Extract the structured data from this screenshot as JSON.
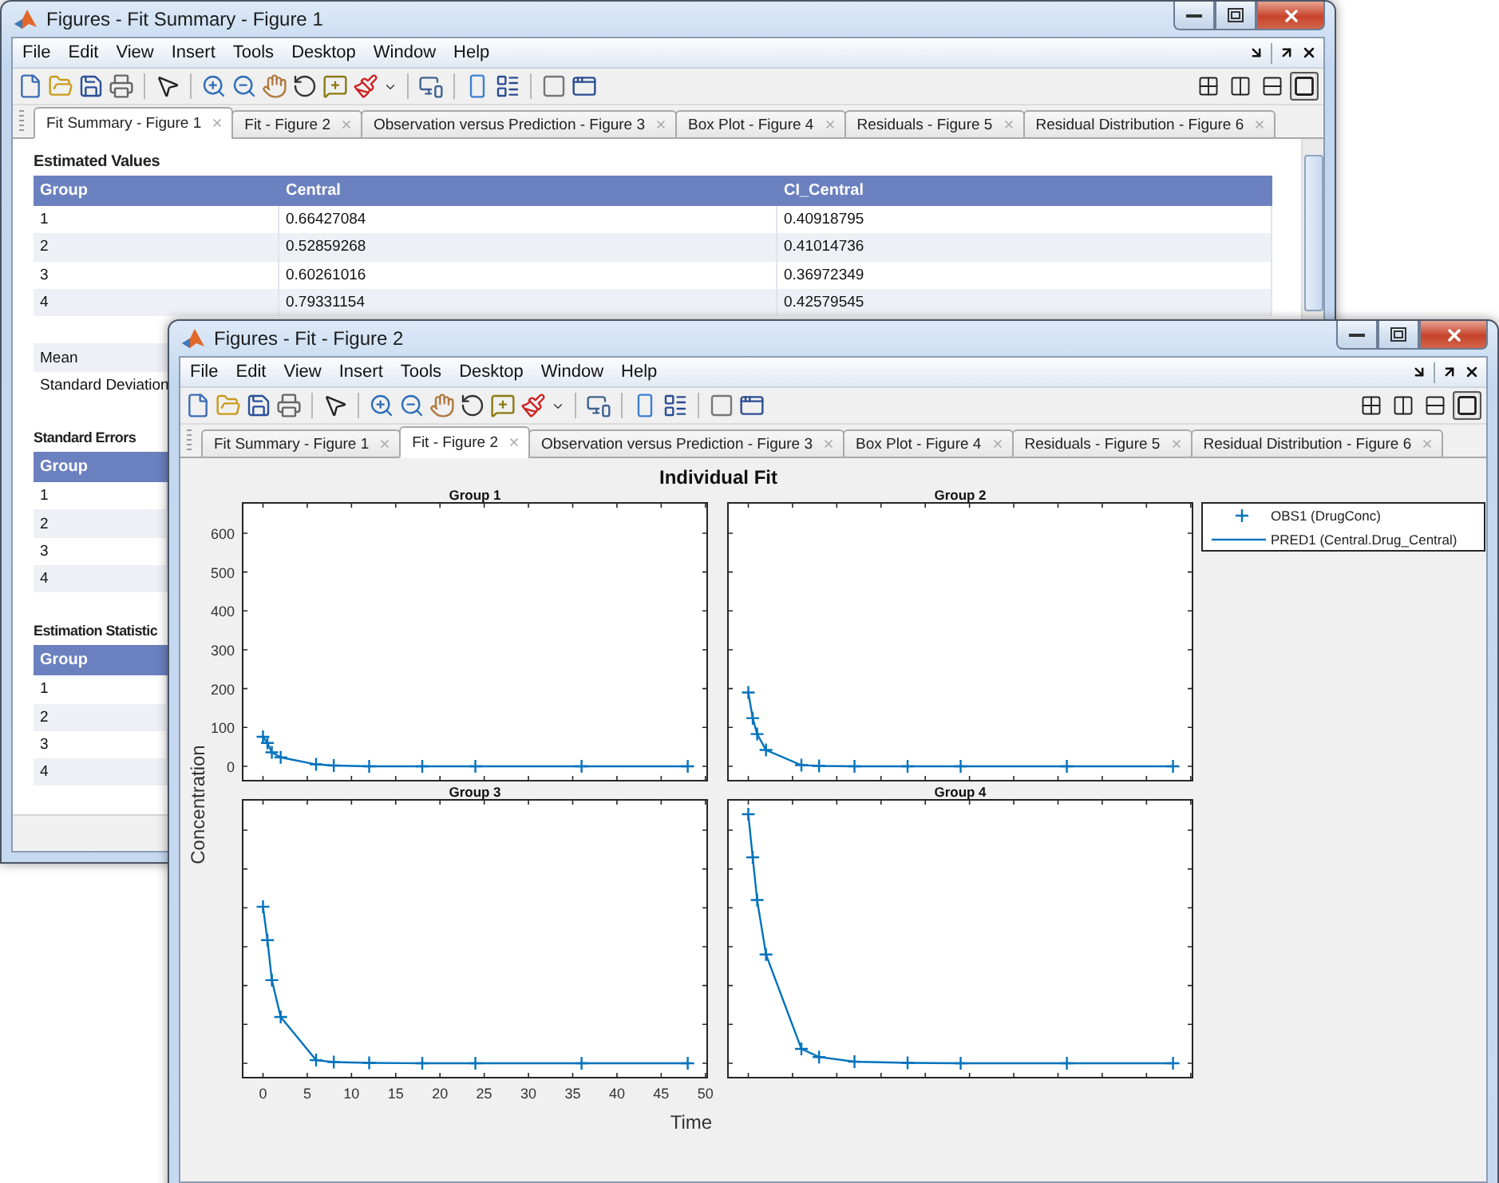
{
  "windows": [
    {
      "title": "Figures - Fit Summary - Figure 1",
      "menu": [
        "File",
        "Edit",
        "View",
        "Insert",
        "Tools",
        "Desktop",
        "Window",
        "Help"
      ],
      "layouts": [
        {
          "kind": "grid",
          "selected": false
        },
        {
          "kind": "columns",
          "selected": false
        },
        {
          "kind": "rows",
          "selected": false
        },
        {
          "kind": "single",
          "selected": true
        }
      ],
      "tabs": [
        {
          "label": "Fit Summary - Figure 1",
          "selected": true
        },
        {
          "label": "Fit - Figure 2",
          "selected": false
        },
        {
          "label": "Observation versus Prediction - Figure 3",
          "selected": false
        },
        {
          "label": "Box Plot - Figure 4",
          "selected": false
        },
        {
          "label": "Residuals - Figure 5",
          "selected": false
        },
        {
          "label": "Residual Distribution - Figure 6",
          "selected": false
        }
      ],
      "content": {
        "kind": "summary",
        "sections": [
          {
            "title": "Estimated Values",
            "columns": [
              "Group",
              "Central",
              "CI_Central"
            ],
            "rows": [
              {
                "kind": "data",
                "cells": [
                  "1",
                  "0.66427084",
                  "0.40918795"
                ]
              },
              {
                "kind": "data",
                "cells": [
                  "2",
                  "0.52859268",
                  "0.41014736"
                ]
              },
              {
                "kind": "data",
                "cells": [
                  "3",
                  "0.60261016",
                  "0.36972349"
                ]
              },
              {
                "kind": "data",
                "cells": [
                  "4",
                  "0.79331154",
                  "0.42579545"
                ]
              },
              {
                "kind": "blank"
              },
              {
                "kind": "data",
                "cells": [
                  "Mean"
                ]
              },
              {
                "kind": "data",
                "cells": [
                  "Standard Deviation"
                ]
              }
            ]
          },
          {
            "title": "Standard Errors",
            "columns": [
              "Group"
            ],
            "rows": [
              {
                "kind": "data",
                "cells": [
                  "1"
                ]
              },
              {
                "kind": "data",
                "cells": [
                  "2"
                ]
              },
              {
                "kind": "data",
                "cells": [
                  "3"
                ]
              },
              {
                "kind": "data",
                "cells": [
                  "4"
                ]
              }
            ]
          },
          {
            "title": "Estimation Statistic",
            "columns": [
              "Group"
            ],
            "rows": [
              {
                "kind": "data",
                "cells": [
                  "1"
                ]
              },
              {
                "kind": "data",
                "cells": [
                  "2"
                ]
              },
              {
                "kind": "data",
                "cells": [
                  "3"
                ]
              },
              {
                "kind": "data",
                "cells": [
                  "4"
                ]
              }
            ]
          }
        ]
      }
    },
    {
      "title": "Figures - Fit - Figure 2",
      "menu": [
        "File",
        "Edit",
        "View",
        "Insert",
        "Tools",
        "Desktop",
        "Window",
        "Help"
      ],
      "layouts": [
        {
          "kind": "grid",
          "selected": false
        },
        {
          "kind": "columns",
          "selected": false
        },
        {
          "kind": "rows",
          "selected": false
        },
        {
          "kind": "single",
          "selected": true
        }
      ],
      "tabs": [
        {
          "label": "Fit Summary - Figure 1",
          "selected": false
        },
        {
          "label": "Fit - Figure 2",
          "selected": true
        },
        {
          "label": "Observation versus Prediction - Figure 3",
          "selected": false
        },
        {
          "label": "Box Plot - Figure 4",
          "selected": false
        },
        {
          "label": "Residuals - Figure 5",
          "selected": false
        },
        {
          "label": "Residual Distribution - Figure 6",
          "selected": false
        }
      ],
      "content": {
        "kind": "figure",
        "title": "Individual Fit",
        "ylabel": "Concentration",
        "xlabel": "Time",
        "legend": [
          {
            "kind": "marker",
            "label": "OBS1 (DrugConc)",
            "color": "#0072bd"
          },
          {
            "kind": "line",
            "label": "PRED1 (Central.Drug_Central)",
            "color": "#0072bd"
          }
        ],
        "panels": [
          {
            "kind": "sketch",
            "title": "Group 1",
            "ytick_labels": [
              "600",
              "500",
              "400",
              "300",
              "200",
              "100",
              "0"
            ]
          },
          {
            "kind": "sketch",
            "title": "Group 2"
          },
          {
            "kind": "sketch",
            "title": "Group 3",
            "tick_labels": [
              "0",
              "5",
              "10",
              "15",
              "20",
              "25",
              "30",
              "35",
              "40",
              "45",
              "50"
            ]
          },
          {
            "kind": "sketch",
            "title": "Group 4"
          }
        ]
      }
    }
  ]
}
